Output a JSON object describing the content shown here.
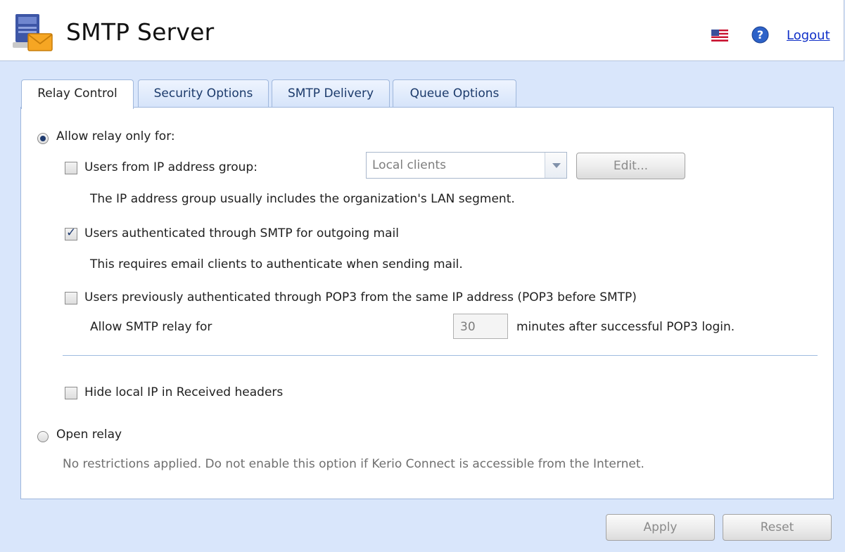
{
  "header": {
    "title": "SMTP Server",
    "logout_label": "Logout",
    "icons": [
      "smtp-server-icon",
      "us-flag-icon",
      "help-icon"
    ]
  },
  "tabs": [
    {
      "label": "Relay Control",
      "active": true
    },
    {
      "label": "Security Options",
      "active": false
    },
    {
      "label": "SMTP Delivery",
      "active": false
    },
    {
      "label": "Queue Options",
      "active": false
    }
  ],
  "relay": {
    "allow_only_label": "Allow relay only for:",
    "allow_only_selected": true,
    "ip_group": {
      "label": "Users from IP address group:",
      "checked": false,
      "selected_group": "Local clients",
      "edit_label": "Edit...",
      "description": "The IP address group usually includes the organization's LAN segment."
    },
    "smtp_auth": {
      "label": "Users authenticated through SMTP for outgoing mail",
      "checked": true,
      "description": "This requires email clients to authenticate when sending mail."
    },
    "pop3": {
      "label": "Users previously authenticated through POP3 from the same IP address (POP3 before SMTP)",
      "checked": false,
      "allow_prefix": "Allow SMTP relay for",
      "minutes": "30",
      "allow_suffix": "minutes after successful POP3 login."
    },
    "hide_ip": {
      "label": "Hide local IP in Received headers",
      "checked": false
    },
    "open_relay": {
      "label": "Open relay",
      "selected": false,
      "description": "No restrictions applied. Do not enable this option if Kerio Connect is accessible from the Internet."
    }
  },
  "footer": {
    "apply_label": "Apply",
    "reset_label": "Reset"
  },
  "colors": {
    "background": "#d9e6fb",
    "link": "#1030c8",
    "tab_border": "#9fb7dc"
  }
}
